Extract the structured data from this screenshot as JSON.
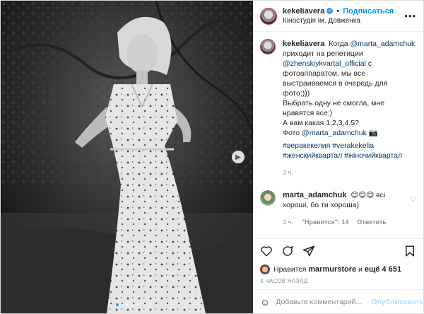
{
  "post": {
    "author": "kekeliavera",
    "follow_label": "Подписаться",
    "location": "Кіностудія ім. Довженка",
    "separator": "•",
    "more_icon": "more-horizontal-icon"
  },
  "caption": {
    "author": "kekeliavera",
    "t1": "Когда",
    "mention1": "@marta_adamchuk",
    "t2": "приходит на репетиции",
    "mention2": "@zhenskiykvartal_official",
    "t3": "с фотоаппаратом, мы все выстраиваемся в очередь для фото;)))",
    "t4": "Выбрать одну не смогла, мне нравятся все;)",
    "t5": "А вам какая 1,2,3,4,5?",
    "t6": "Фото",
    "mention3": "@marta_adamchuk",
    "t6_suffix": "📷",
    "hashtags": [
      "#веракекелия",
      "#verakekelia",
      "#женскийквартал",
      "#жіночийквартал"
    ],
    "time": "3 ч."
  },
  "reply": {
    "author": "marta_adamchuk",
    "text": "😊😊😊 всі хороші, бо ти хороша)",
    "time": "3 ч.",
    "likes": "\"Нравится\": 14",
    "reply_label": "Ответить"
  },
  "actions": {
    "like_icon": "heart-icon",
    "comment_icon": "comment-icon",
    "share_icon": "share-icon",
    "save_icon": "bookmark-icon"
  },
  "likes": {
    "prefix": "Нравится",
    "user": "marmurstore",
    "middle": "и",
    "count": "ещё 4 651"
  },
  "date": "3 ЧАСОВ НАЗАД",
  "comment_box": {
    "placeholder": "Добавьте комментарий...",
    "publish_label": "Опубликовать",
    "emoji_icon": "emoji-icon"
  },
  "carousel": {
    "slides": 5,
    "active": 1
  }
}
